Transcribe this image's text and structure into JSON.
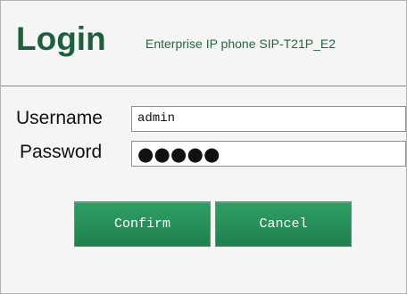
{
  "header": {
    "title": "Login",
    "subtitle": "Enterprise IP phone SIP-T21P_E2"
  },
  "form": {
    "username_label": "Username",
    "username_value": "admin",
    "password_label": "Password",
    "password_masked": "●●●●●"
  },
  "buttons": {
    "confirm_label": "Confirm",
    "cancel_label": "Cancel"
  },
  "colors": {
    "brand_green": "#1e5f3c",
    "button_green": "#278f58"
  }
}
